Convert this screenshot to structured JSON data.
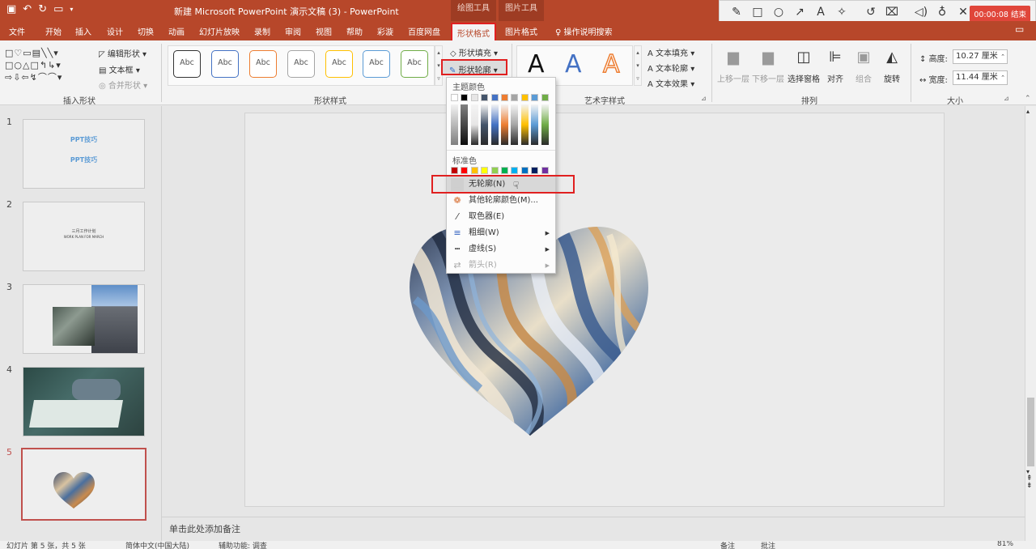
{
  "title_bar": {
    "document_title": "新建 Microsoft PowerPoint 演示文稿 (3)  -  PowerPoint",
    "context_tabs": [
      "绘图工具",
      "图片工具"
    ],
    "recorder": {
      "timer": "00:00:08 结束"
    }
  },
  "ribbon_tabs": [
    "文件",
    "开始",
    "插入",
    "设计",
    "切换",
    "动画",
    "幻灯片放映",
    "录制",
    "审阅",
    "视图",
    "帮助",
    "彩漩",
    "百度网盘",
    "形状格式",
    "图片格式",
    "操作说明搜索"
  ],
  "active_tab": "形状格式",
  "ribbon": {
    "insert_shapes": {
      "label": "插入形状",
      "edit_shape": "编辑形状",
      "text_box": "文本框",
      "merge_shapes": "合并形状"
    },
    "shape_styles": {
      "label": "形状样式",
      "style_samples": [
        "Abc",
        "Abc",
        "Abc",
        "Abc",
        "Abc",
        "Abc",
        "Abc"
      ],
      "style_colors": [
        "#333333",
        "#4472c4",
        "#ed7d31",
        "#a5a5a5",
        "#ffc000",
        "#5b9bd5",
        "#70ad47"
      ],
      "fill": "形状填充",
      "outline": "形状轮廓"
    },
    "wordart": {
      "label": "艺术字样式",
      "letters": [
        "A",
        "A",
        "A"
      ],
      "text_fill": "文本填充",
      "text_outline": "文本轮廓",
      "text_effects": "文本效果"
    },
    "arrange": {
      "label": "排列",
      "bring_forward": "上移一层",
      "send_backward": "下移一层",
      "selection_pane": "选择窗格",
      "align": "对齐",
      "group": "组合",
      "rotate": "旋转"
    },
    "size": {
      "label": "大小",
      "height_label": "高度:",
      "height_value": "10.27 厘米",
      "width_label": "宽度:",
      "width_value": "11.44 厘米"
    }
  },
  "outline_menu": {
    "theme_colors_header": "主题颜色",
    "theme_colors": [
      "#ffffff",
      "#000000",
      "#e7e6e6",
      "#44546a",
      "#4472c4",
      "#ed7d31",
      "#a5a5a5",
      "#ffc000",
      "#5b9bd5",
      "#70ad47"
    ],
    "standard_colors_header": "标准色",
    "standard_colors": [
      "#c00000",
      "#ff0000",
      "#ffc000",
      "#ffff00",
      "#92d050",
      "#00b050",
      "#00b0f0",
      "#0070c0",
      "#002060",
      "#7030a0"
    ],
    "items": [
      {
        "label": "无轮廓(N)",
        "icon": "no-outline-swatch-icon",
        "highlighted": true,
        "submenu": false,
        "disabled": false
      },
      {
        "label": "其他轮廓颜色(M)...",
        "icon": "color-palette-icon",
        "highlighted": false,
        "submenu": false,
        "disabled": false
      },
      {
        "label": "取色器(E)",
        "icon": "eyedropper-icon",
        "highlighted": false,
        "submenu": false,
        "disabled": false
      },
      {
        "label": "粗细(W)",
        "icon": "line-weight-icon",
        "highlighted": false,
        "submenu": true,
        "disabled": false
      },
      {
        "label": "虚线(S)",
        "icon": "dashes-icon",
        "highlighted": false,
        "submenu": true,
        "disabled": false
      },
      {
        "label": "箭头(R)",
        "icon": "arrows-icon",
        "highlighted": false,
        "submenu": true,
        "disabled": true
      }
    ]
  },
  "slides": [
    {
      "number": "1",
      "lines": [
        "PPT技巧",
        "PPT技巧"
      ]
    },
    {
      "number": "2",
      "lines": [
        "三月工作计划",
        "WORK PLAN FOR MARCH"
      ]
    },
    {
      "number": "3",
      "lines": []
    },
    {
      "number": "4",
      "lines": []
    },
    {
      "number": "5",
      "lines": []
    }
  ],
  "selected_slide": "5",
  "notes_placeholder": "单击此处添加备注",
  "status_bar": {
    "slide_info": "幻灯片 第 5 张，共 5 张",
    "language": "简体中文(中国大陆)",
    "accessibility": "辅助功能: 调查",
    "notes": "备注",
    "comments": "批注",
    "zoom": "81%"
  }
}
